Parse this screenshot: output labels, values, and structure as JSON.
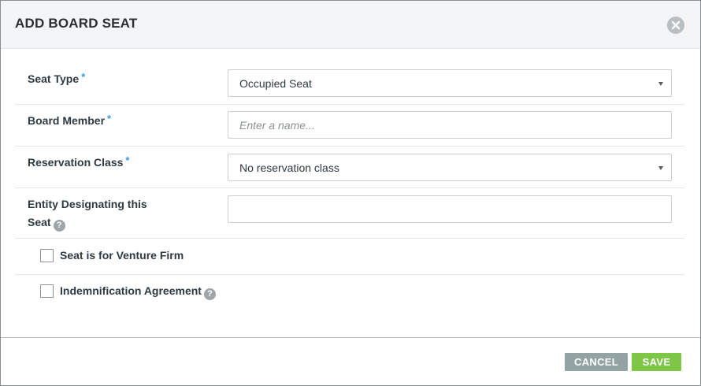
{
  "modal": {
    "title": "ADD BOARD SEAT",
    "close_icon": "close-circle-icon"
  },
  "fields": {
    "seat_type": {
      "label": "Seat Type",
      "required_mark": "*",
      "value": "Occupied Seat"
    },
    "board_member": {
      "label": "Board Member",
      "required_mark": "*",
      "placeholder": "Enter a name...",
      "value": ""
    },
    "reservation_class": {
      "label": "Reservation Class",
      "required_mark": "*",
      "value": "No reservation class"
    },
    "entity": {
      "label_line1": "Entity Designating this",
      "label_line2": "Seat",
      "help_icon": "question-circle-icon",
      "value": ""
    }
  },
  "checkboxes": {
    "venture_firm": {
      "label": "Seat is for Venture Firm",
      "checked": false
    },
    "indemnification": {
      "label": "Indemnification Agreement",
      "checked": false,
      "help_icon": "question-circle-icon"
    }
  },
  "help_glyph": "?",
  "footer": {
    "cancel_label": "CANCEL",
    "save_label": "SAVE"
  },
  "colors": {
    "required_asterisk": "#3b9ad9",
    "cancel_button": "#93a3a4",
    "save_button": "#7dc646",
    "header_background": "#f3f5f6"
  }
}
